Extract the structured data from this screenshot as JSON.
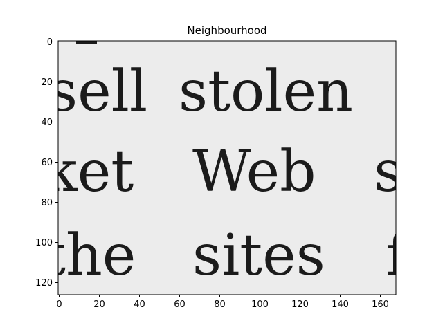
{
  "figure": {
    "title": "Neighbourhood",
    "x_ticks": [
      "0",
      "20",
      "40",
      "60",
      "80",
      "100",
      "120",
      "140",
      "160"
    ],
    "y_ticks": [
      "0",
      "20",
      "40",
      "60",
      "80",
      "100",
      "120"
    ],
    "image": {
      "lines": [
        {
          "words": [
            "sell",
            "stolen"
          ]
        },
        {
          "words": [
            "ket",
            "Web",
            "s"
          ]
        },
        {
          "words": [
            "the",
            "sites",
            "f"
          ]
        }
      ],
      "background_color": "#ececec",
      "ink_color": "#1b1b1b"
    }
  }
}
